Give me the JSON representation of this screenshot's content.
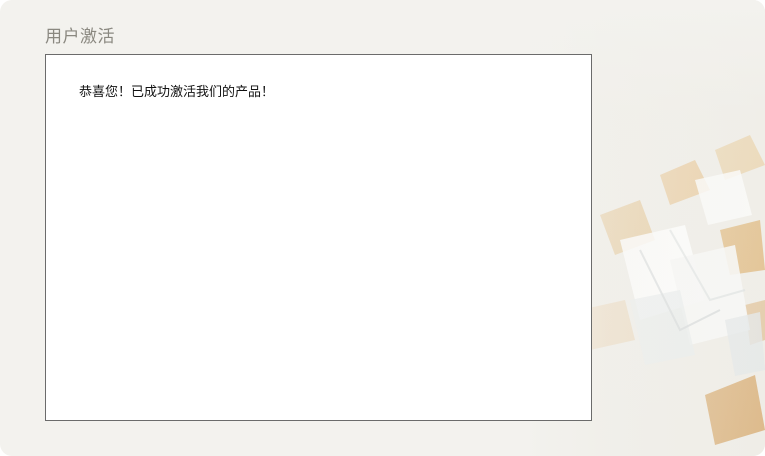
{
  "page": {
    "title": "用户激活"
  },
  "content": {
    "message": "恭喜您！已成功激活我们的产品！"
  },
  "colors": {
    "panel_background": "#f3f2ee",
    "title_text": "#8a8880",
    "box_border": "#6b6b6b",
    "message_text": "#111111",
    "accent_tan": "#e2c08e"
  }
}
